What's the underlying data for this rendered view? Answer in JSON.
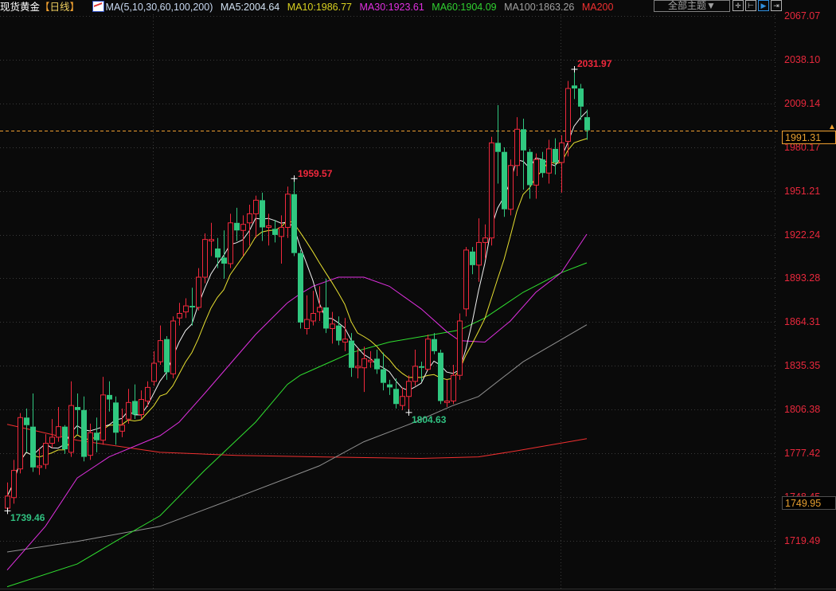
{
  "header": {
    "title": "现货黄金",
    "bracket_open": "【",
    "period": "日线",
    "bracket_close": "】",
    "ma_label": "MA(5,10,30,60,100,200)",
    "ma5": "MA5:2004.64",
    "ma10": "MA10:1986.77",
    "ma30": "MA30:1923.61",
    "ma60": "MA60:1904.09",
    "ma100": "MA100:1863.26",
    "ma200": "MA200"
  },
  "toolbar": {
    "theme_label": "全部主题▼",
    "tools": [
      {
        "icon": "crosshair-icon",
        "glyph": "✛"
      },
      {
        "icon": "range-icon",
        "glyph": "⊢"
      },
      {
        "icon": "play-cursor-icon",
        "glyph": "▶"
      },
      {
        "icon": "move-right-icon",
        "glyph": "⇥"
      }
    ]
  },
  "colors": {
    "up": "#f0283c",
    "down": "#30c880",
    "ma5": "#f0f0f0",
    "ma10": "#e8e030",
    "ma30": "#e030e0",
    "ma60": "#30e030",
    "ma100": "#909090",
    "ma200": "#f03030",
    "grid": "#3a3a3a",
    "current": "#f0a030"
  },
  "axis": {
    "ticks": [
      "2067.07",
      "2038.10",
      "2009.14",
      "1980.17",
      "1951.21",
      "1922.24",
      "1893.28",
      "1864.31",
      "1835.35",
      "1806.38",
      "1777.42",
      "1748.45",
      "1719.49"
    ],
    "current_price": "1991.31",
    "marker_price": "1749.95"
  },
  "annotations": {
    "high1": "2031.97",
    "high2": "1959.57",
    "low1": "1804.63",
    "low2": "1739.46"
  },
  "chart_data": {
    "type": "candlestick",
    "ylim": [
      1690,
      2075
    ],
    "candles_ohlc": [
      [
        1741,
        1758,
        1739.46,
        1749
      ],
      [
        1748,
        1773,
        1744,
        1766
      ],
      [
        1767,
        1804,
        1764,
        1801
      ],
      [
        1801,
        1807,
        1778,
        1796
      ],
      [
        1795,
        1817,
        1765,
        1768
      ],
      [
        1768,
        1781,
        1763,
        1769
      ],
      [
        1770,
        1790,
        1767,
        1784
      ],
      [
        1784,
        1800,
        1781,
        1788
      ],
      [
        1788,
        1808,
        1785,
        1795
      ],
      [
        1795,
        1796,
        1777,
        1780
      ],
      [
        1778,
        1825,
        1775,
        1809
      ],
      [
        1808,
        1817,
        1790,
        1806
      ],
      [
        1806,
        1815,
        1772,
        1775
      ],
      [
        1776,
        1797,
        1773,
        1791
      ],
      [
        1791,
        1801,
        1778,
        1786
      ],
      [
        1786,
        1828,
        1783,
        1816
      ],
      [
        1816,
        1825,
        1805,
        1813
      ],
      [
        1811,
        1815,
        1783,
        1791
      ],
      [
        1792,
        1807,
        1788,
        1796
      ],
      [
        1800,
        1820,
        1797,
        1811
      ],
      [
        1812,
        1823,
        1800,
        1803
      ],
      [
        1803,
        1819,
        1800,
        1813
      ],
      [
        1812,
        1825,
        1808,
        1821
      ],
      [
        1825,
        1845,
        1822,
        1837
      ],
      [
        1838,
        1862,
        1836,
        1852
      ],
      [
        1853,
        1855,
        1826,
        1831
      ],
      [
        1830,
        1868,
        1827,
        1865
      ],
      [
        1867,
        1877,
        1862,
        1870
      ],
      [
        1871,
        1880,
        1867,
        1875
      ],
      [
        1875,
        1887,
        1862,
        1874
      ],
      [
        1874,
        1900,
        1872,
        1894
      ],
      [
        1894,
        1923,
        1890,
        1919
      ],
      [
        1918,
        1930,
        1908,
        1919
      ],
      [
        1913,
        1920,
        1900,
        1907
      ],
      [
        1907,
        1925,
        1893,
        1903
      ],
      [
        1903,
        1936,
        1900,
        1930
      ],
      [
        1930,
        1940,
        1918,
        1925
      ],
      [
        1925,
        1935,
        1908,
        1929
      ],
      [
        1930,
        1942,
        1915,
        1936
      ],
      [
        1936,
        1948,
        1920,
        1945
      ],
      [
        1945,
        1950,
        1918,
        1927
      ],
      [
        1927,
        1936,
        1915,
        1928
      ],
      [
        1926,
        1932,
        1917,
        1922
      ],
      [
        1921,
        1935,
        1903,
        1927
      ],
      [
        1927,
        1954,
        1920,
        1949
      ],
      [
        1949,
        1959.57,
        1908,
        1910
      ],
      [
        1910,
        1912,
        1860,
        1864
      ],
      [
        1860,
        1882,
        1856,
        1866
      ],
      [
        1865,
        1885,
        1862,
        1870
      ],
      [
        1871,
        1888,
        1865,
        1874
      ],
      [
        1874,
        1893,
        1857,
        1860
      ],
      [
        1860,
        1871,
        1850,
        1863
      ],
      [
        1862,
        1868,
        1849,
        1852
      ],
      [
        1851,
        1867,
        1845,
        1853
      ],
      [
        1852,
        1857,
        1828,
        1834
      ],
      [
        1834,
        1847,
        1827,
        1835
      ],
      [
        1834,
        1848,
        1818,
        1840
      ],
      [
        1838,
        1845,
        1834,
        1839
      ],
      [
        1840,
        1846,
        1830,
        1833
      ],
      [
        1833,
        1844,
        1819,
        1824
      ],
      [
        1823,
        1826,
        1816,
        1821
      ],
      [
        1820,
        1827,
        1807,
        1810
      ],
      [
        1809,
        1821,
        1806,
        1815
      ],
      [
        1815,
        1829,
        1804.63,
        1825
      ],
      [
        1825,
        1846,
        1822,
        1835
      ],
      [
        1835,
        1838,
        1825,
        1834
      ],
      [
        1833,
        1856,
        1832,
        1853
      ],
      [
        1853,
        1857,
        1843,
        1845
      ],
      [
        1844,
        1846,
        1810,
        1812
      ],
      [
        1811,
        1826,
        1808,
        1812
      ],
      [
        1812,
        1836,
        1810,
        1829
      ],
      [
        1829,
        1870,
        1826,
        1865
      ],
      [
        1873,
        1914,
        1868,
        1912
      ],
      [
        1911,
        1914,
        1896,
        1902
      ],
      [
        1902,
        1933,
        1891,
        1917
      ],
      [
        1917,
        1929,
        1906,
        1920
      ],
      [
        1920,
        1987,
        1915,
        1983
      ],
      [
        1983,
        2008,
        1956,
        1977
      ],
      [
        1977,
        1980,
        1934,
        1939
      ],
      [
        1939,
        1972,
        1935,
        1968
      ],
      [
        1968,
        2000,
        1961,
        1992
      ],
      [
        1992,
        1999,
        1952,
        1978
      ],
      [
        1977,
        1979,
        1946,
        1955
      ],
      [
        1955,
        1976,
        1946,
        1972
      ],
      [
        1972,
        1977,
        1960,
        1963
      ],
      [
        1963,
        1985,
        1956,
        1979
      ],
      [
        1979,
        1986,
        1962,
        1970
      ],
      [
        1970,
        1988,
        1950,
        1983
      ],
      [
        1984,
        2024,
        1974,
        2019
      ],
      [
        2021,
        2031.97,
        2012,
        2019
      ],
      [
        2019,
        2022,
        1998,
        2007
      ],
      [
        2000,
        2005,
        1985,
        1991.31
      ]
    ],
    "ma_keypoints": {
      "ma30": [
        [
          0,
          1700
        ],
        [
          6,
          1729
        ],
        [
          11,
          1761
        ],
        [
          16,
          1775
        ],
        [
          24,
          1789
        ],
        [
          27,
          1798
        ],
        [
          31,
          1817
        ],
        [
          39,
          1856
        ],
        [
          44,
          1877
        ],
        [
          46,
          1883
        ],
        [
          48,
          1888
        ],
        [
          52,
          1894
        ],
        [
          56,
          1894
        ],
        [
          60,
          1888
        ],
        [
          65,
          1873
        ],
        [
          69,
          1858
        ],
        [
          71,
          1852
        ],
        [
          75,
          1851
        ],
        [
          79,
          1865
        ],
        [
          83,
          1884
        ],
        [
          87,
          1897
        ],
        [
          91,
          1922.5
        ]
      ],
      "ma60": [
        [
          0,
          1689
        ],
        [
          11,
          1704
        ],
        [
          17,
          1719
        ],
        [
          24,
          1736
        ],
        [
          31,
          1766
        ],
        [
          39,
          1798
        ],
        [
          44,
          1823
        ],
        [
          46,
          1829
        ],
        [
          50,
          1836.5
        ],
        [
          54,
          1844
        ],
        [
          60,
          1851
        ],
        [
          67,
          1856
        ],
        [
          71,
          1859
        ],
        [
          75,
          1867
        ],
        [
          81,
          1884
        ],
        [
          87,
          1897
        ],
        [
          91,
          1903.5
        ]
      ],
      "ma100": [
        [
          0,
          1712
        ],
        [
          11,
          1719
        ],
        [
          24,
          1729
        ],
        [
          36,
          1748
        ],
        [
          49,
          1769
        ],
        [
          56,
          1785
        ],
        [
          64,
          1798
        ],
        [
          70,
          1809
        ],
        [
          74,
          1815
        ],
        [
          81,
          1838
        ],
        [
          91,
          1862.5
        ]
      ],
      "ma200": [
        [
          0,
          1796.5
        ],
        [
          11,
          1786
        ],
        [
          24,
          1778
        ],
        [
          36,
          1776
        ],
        [
          49,
          1775
        ],
        [
          65,
          1774
        ],
        [
          74,
          1775
        ],
        [
          80,
          1779
        ],
        [
          91,
          1787
        ]
      ]
    }
  }
}
